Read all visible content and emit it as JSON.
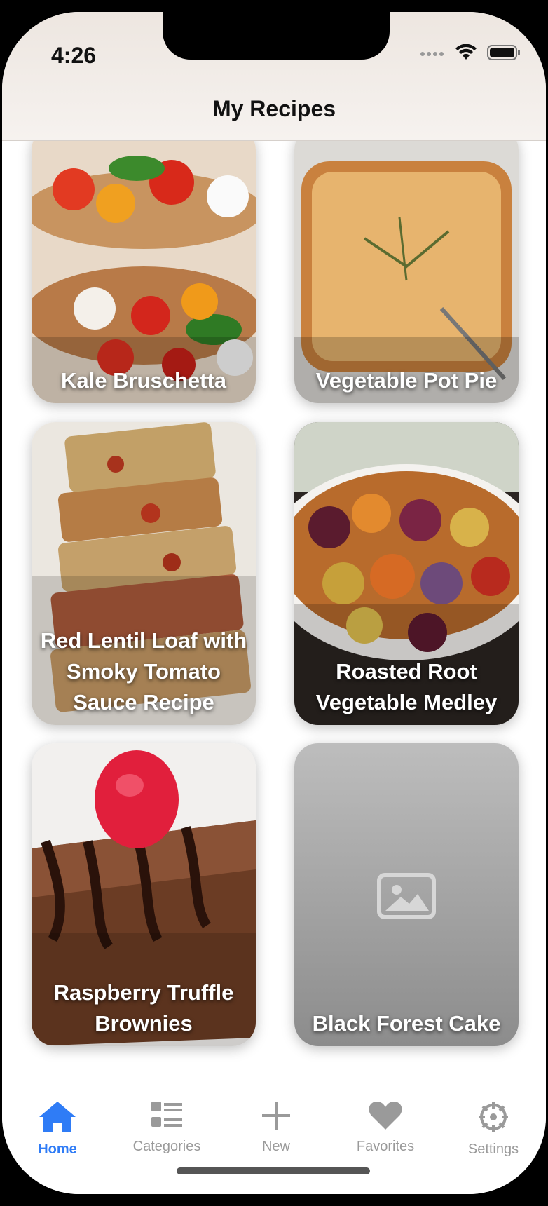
{
  "status_bar": {
    "time": "4:26"
  },
  "nav": {
    "title": "My Recipes"
  },
  "recipes": [
    {
      "name": "Kale Bruschetta"
    },
    {
      "name": "Vegetable Pot Pie"
    },
    {
      "name": "Red Lentil Loaf with Smoky Tomato Sauce Recipe"
    },
    {
      "name": "Roasted Root Vegetable Medley"
    },
    {
      "name": "Raspberry Truffle Brownies"
    },
    {
      "name": "Black Forest Cake"
    }
  ],
  "tabbar": {
    "items": [
      {
        "label": "Home",
        "icon": "house-icon",
        "active": true
      },
      {
        "label": "Categories",
        "icon": "list-icon",
        "active": false
      },
      {
        "label": "New",
        "icon": "plus-icon",
        "active": false
      },
      {
        "label": "Favorites",
        "icon": "heart-icon",
        "active": false
      },
      {
        "label": "Settings",
        "icon": "gear-icon",
        "active": false
      }
    ]
  },
  "colors": {
    "accent": "#2f7cf6",
    "inactive": "#9a9a9a"
  }
}
